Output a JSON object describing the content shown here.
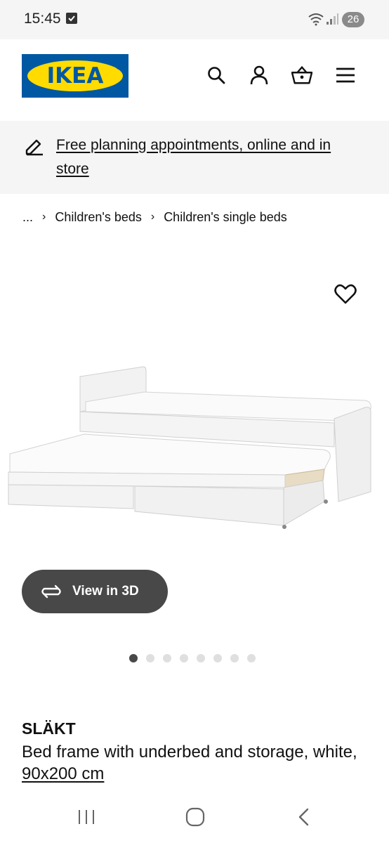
{
  "status_bar": {
    "time": "15:45",
    "battery": "26"
  },
  "header": {
    "logo_text": "IKEA",
    "icons": [
      "search-icon",
      "account-icon",
      "basket-icon",
      "menu-icon"
    ]
  },
  "banner": {
    "link_text": "Free planning appointments, online and in store",
    "icon": "pencil-icon"
  },
  "breadcrumb": {
    "ellipsis": "...",
    "items": [
      "Children's beds",
      "Children's single beds"
    ]
  },
  "product": {
    "view3d_label": "View in 3D",
    "image_count": 8,
    "active_image": 1,
    "name": "SLÄKT",
    "description": "Bed frame with underbed and storage, white,",
    "size_link": "90x200 cm"
  },
  "colors": {
    "ikea_blue": "#0058a3",
    "ikea_yellow": "#ffdb00",
    "button_dark": "#484848",
    "banner_bg": "#f5f5f5"
  }
}
